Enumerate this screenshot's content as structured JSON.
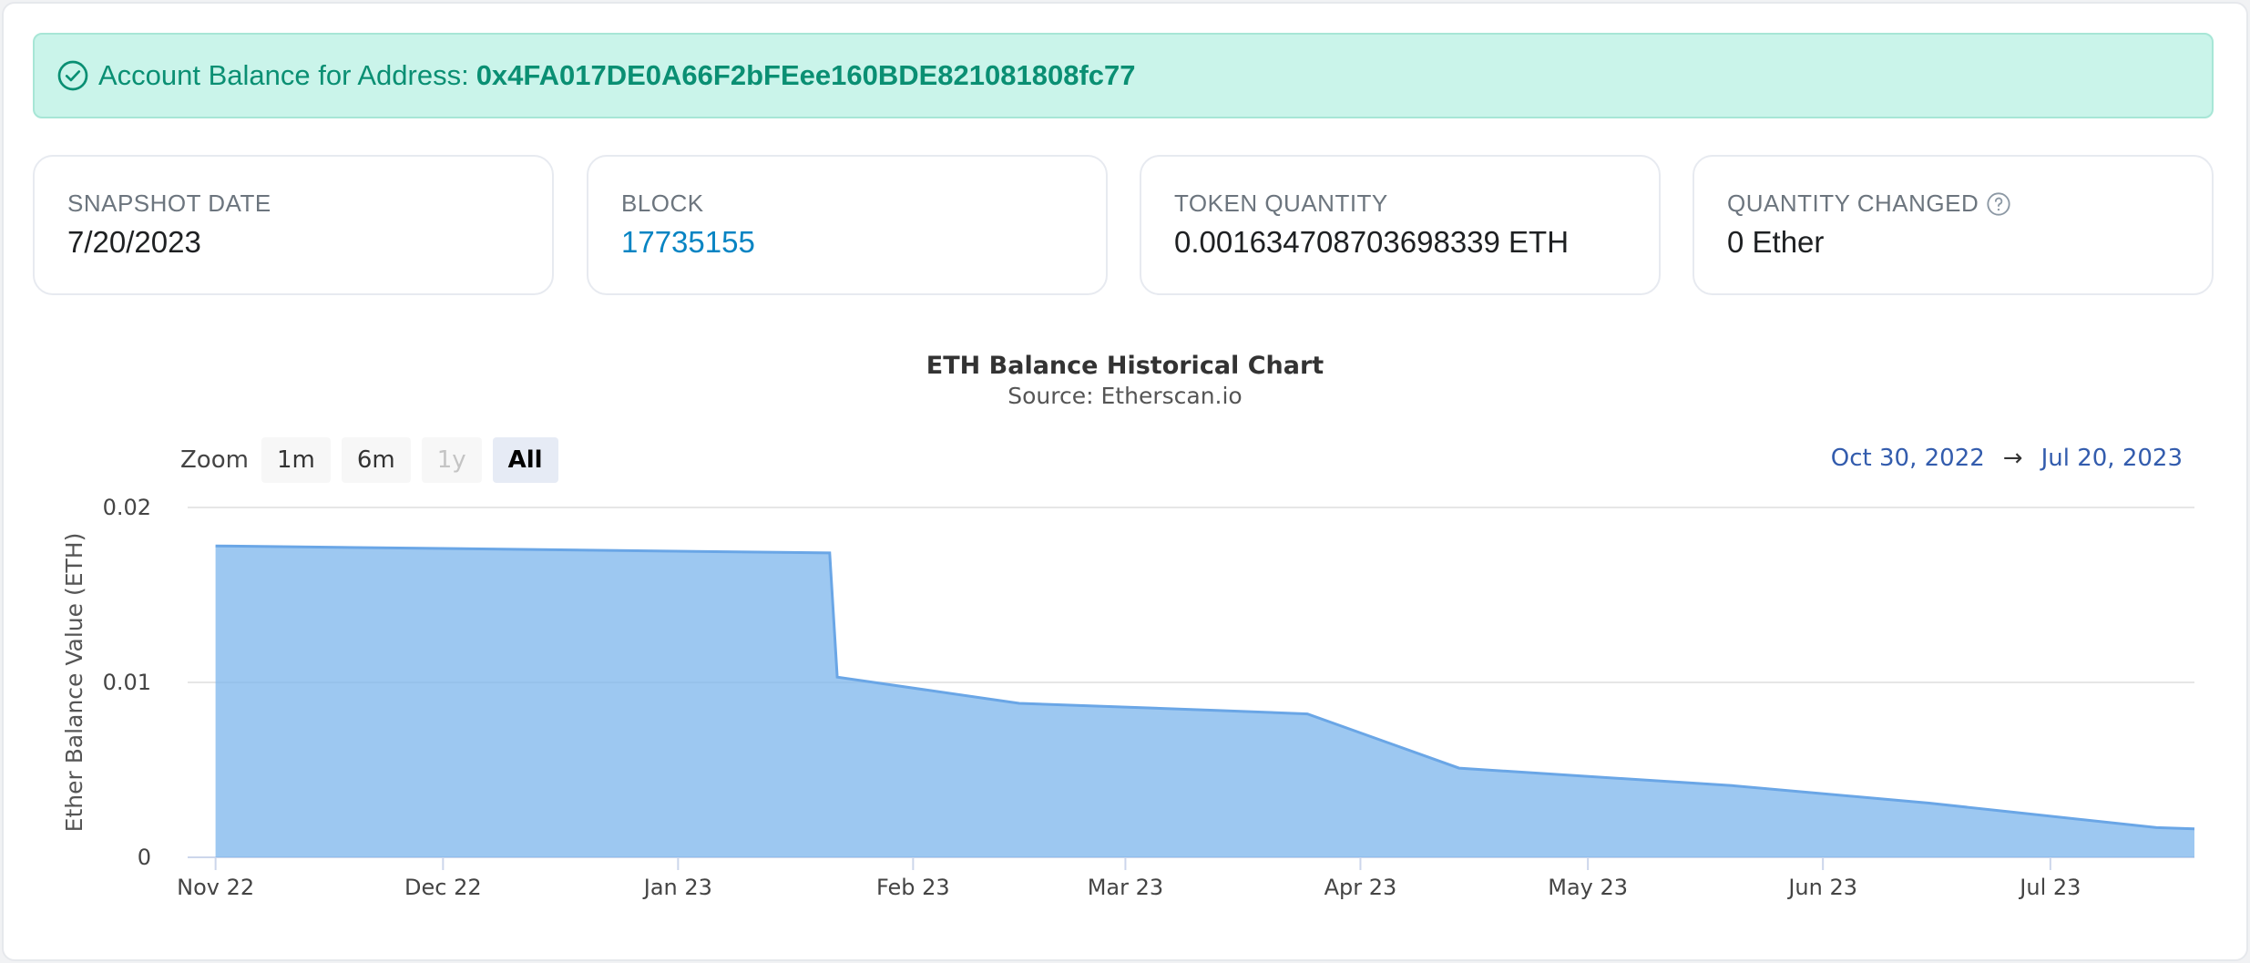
{
  "alert": {
    "label": "Account Balance for Address:",
    "address": "0x4FA017DE0A66F2bFEee160BDE821081808fc77"
  },
  "cards": [
    {
      "label": "SNAPSHOT DATE",
      "value": "7/20/2023"
    },
    {
      "label": "BLOCK",
      "value": "17735155"
    },
    {
      "label": "TOKEN QUANTITY",
      "value": "0.001634708703698339 ETH"
    },
    {
      "label": "QUANTITY CHANGED",
      "value": "0 Ether"
    }
  ],
  "icons": {
    "alert": "check-circle-icon",
    "help": "question-circle-icon"
  },
  "colors": {
    "accent": "#0a8f73",
    "link": "#0784c3",
    "area": "#7cb5ec"
  },
  "chart_controls": {
    "zoom_label": "Zoom",
    "buttons": [
      {
        "label": "1m",
        "state": "normal"
      },
      {
        "label": "6m",
        "state": "normal"
      },
      {
        "label": "1y",
        "state": "disabled"
      },
      {
        "label": "All",
        "state": "active"
      }
    ],
    "range_from": "Oct 30, 2022",
    "range_arrow": "→",
    "range_to": "Jul 20, 2023"
  },
  "chart_data": {
    "type": "area",
    "title": "ETH Balance Historical Chart",
    "subtitle": "Source: Etherscan.io",
    "ylabel": "Ether Balance Value (ETH)",
    "xlabel": "",
    "ylim": [
      0,
      0.02
    ],
    "yticks": [
      0,
      0.01,
      0.02
    ],
    "ytick_labels": [
      "0",
      "0.01",
      "0.02"
    ],
    "xlim": [
      "2022-10-30",
      "2023-07-20"
    ],
    "xticks": [
      "2022-11-01",
      "2022-12-01",
      "2023-01-01",
      "2023-02-01",
      "2023-03-01",
      "2023-04-01",
      "2023-05-01",
      "2023-06-01",
      "2023-07-01"
    ],
    "xtick_labels": [
      "Nov 22",
      "Dec 22",
      "Jan 23",
      "Feb 23",
      "Mar 23",
      "Apr 23",
      "May 23",
      "Jun 23",
      "Jul 23"
    ],
    "grid": true,
    "legend": "none",
    "series": [
      {
        "x": [
          "2022-11-01",
          "2023-01-21",
          "2023-01-22",
          "2023-02-15",
          "2023-03-13",
          "2023-03-25",
          "2023-04-14",
          "2023-05-20",
          "2023-06-15",
          "2023-07-15",
          "2023-07-20"
        ],
        "y": [
          0.0178,
          0.0174,
          0.0103,
          0.0088,
          0.0084,
          0.0082,
          0.0051,
          0.0041,
          0.0031,
          0.0017,
          0.00163
        ]
      }
    ]
  }
}
